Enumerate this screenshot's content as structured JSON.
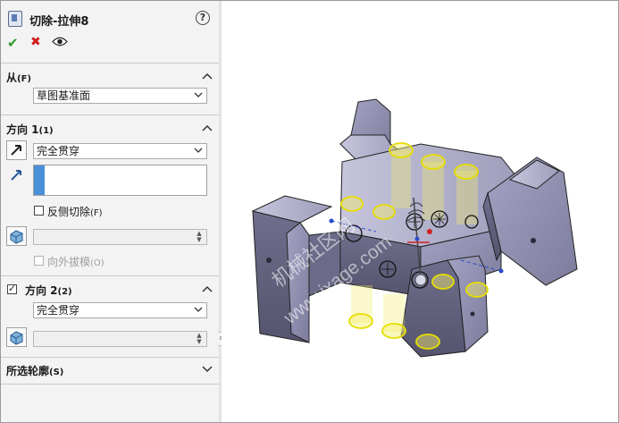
{
  "panel": {
    "title": "切除-拉伸8",
    "help_label": "?",
    "from": {
      "label": "从",
      "label_suffix": "(F)",
      "value": "草图基准面"
    },
    "direction1": {
      "label": "方向 1",
      "label_suffix": "(1)",
      "end_condition": "完全贯穿",
      "flip_side_label": "反侧切除",
      "flip_side_suffix": "(F)",
      "draft_outward_label": "向外拔模",
      "draft_outward_suffix": "(O)"
    },
    "direction2": {
      "label": "方向 2",
      "label_suffix": "(2)",
      "checked": true,
      "end_condition": "完全贯穿"
    },
    "selected_contours": {
      "label": "所选轮廓",
      "label_suffix": "(S)"
    }
  },
  "icons": {
    "title": "extrude-cut-feature-icon",
    "help": "help-icon",
    "ok": "ok-checkmark-icon",
    "cancel": "cancel-x-icon",
    "preview": "eye-icon",
    "reverse_direction": "reverse-direction-icon",
    "direction_vector": "direction-arrow-icon",
    "draft": "draft-icon"
  },
  "watermark": {
    "line1": "机械社区网",
    "line2": "www.jxage.com"
  },
  "colors": {
    "panel_bg": "#f3f3f3",
    "part_face": "#8b8aaa",
    "cut_preview": "#f4ee6a",
    "ok": "#2e9a2e",
    "cancel": "#d12020"
  }
}
